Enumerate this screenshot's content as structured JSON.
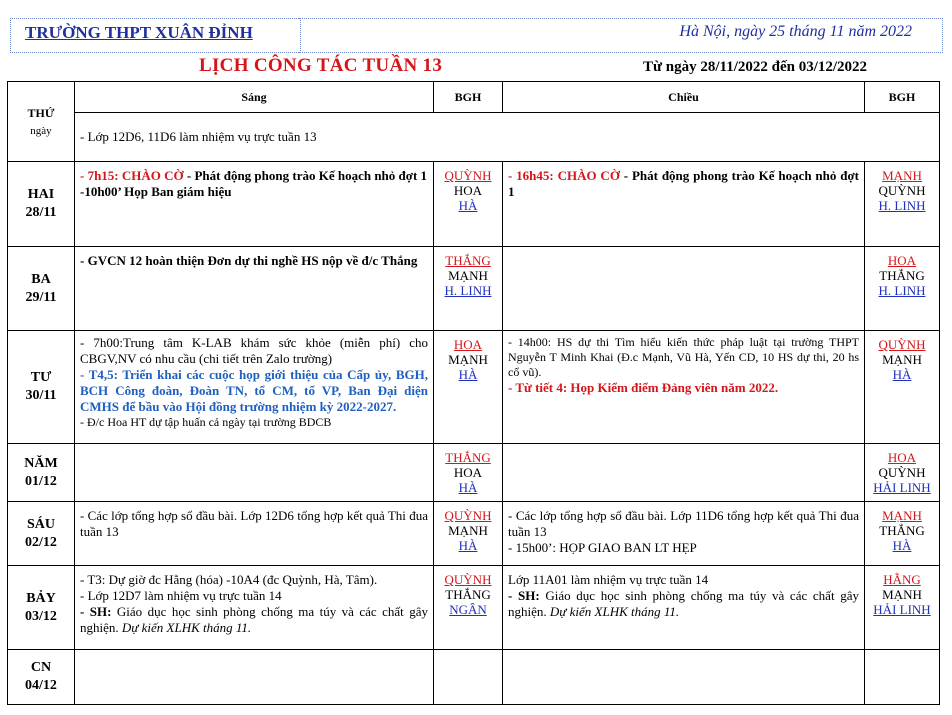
{
  "header": {
    "school": "TRƯỜNG THPT XUÂN ĐỈNH",
    "dateline": "Hà Nội, ngày  25  tháng  11  năm 2022",
    "title": "LỊCH CÔNG TÁC TUẦN 13",
    "range": "Từ ngày 28/11/2022 đến 03/12/2022"
  },
  "columns": {
    "day_line1": "THỨ",
    "day_line2": "ngày",
    "morning": "Sáng",
    "bgh": "BGH",
    "afternoon": "Chiều",
    "bgh2": "BGH"
  },
  "general_note": "- Lớp 12D6, 11D6  làm nhiệm vụ trực tuần 13",
  "rows": {
    "mon": {
      "day": "HAI",
      "date": "28/11",
      "m1_red": "- 7h15: CHÀO CỜ",
      "m1_rest": " - Phát động phong trào Kế hoạch nhỏ đợt 1",
      "m2": "-10h00’ Họp Ban giám hiệu",
      "bgh_m": [
        "QUỲNH",
        "HOA",
        "HÀ"
      ],
      "a1_red": "- 16h45: CHÀO CỜ",
      "a1_rest": " - Phát động phong trào Kế hoạch nhỏ đợt 1",
      "bgh_a": [
        "MẠNH",
        "QUỲNH",
        "H. LINH"
      ]
    },
    "tue": {
      "day": "BA",
      "date": "29/11",
      "m1": "- GVCN 12 hoàn thiện Đơn dự thi nghề HS nộp về đ/c Thắng",
      "bgh_m": [
        "THẮNG",
        "MẠNH",
        "H. LINH"
      ],
      "bgh_a": [
        "HOA",
        "THẮNG",
        "H. LINH"
      ]
    },
    "wed": {
      "day": "TƯ",
      "date": "30/11",
      "m1": "- 7h00:Trung tâm K-LAB khám sức khỏe (miễn phí) cho CBGV,NV có nhu cầu (chi tiết trên Zalo trường)",
      "m2": "- T4,5: Triển khai các cuộc họp giới thiệu của Cấp ủy, BGH, BCH Công đoàn, Đoàn TN, tổ CM, tổ VP,  Ban Đại diện CMHS để bầu vào Hội đồng trường nhiệm kỳ 2022-2027.",
      "m3": "- Đ/c Hoa HT dự tập huấn cả ngày tại trường BDCB",
      "bgh_m": [
        "HOA",
        "MẠNH",
        "HÀ"
      ],
      "a1": "- 14h00: HS dự thi Tìm hiểu kiến thức pháp luật tại trường THPT Nguyễn T Minh Khai (Đ.c Mạnh, Vũ Hà, Yến CD, 10 HS dự thi, 20 hs cổ vũ).",
      "a2": "- Từ tiết 4: Họp Kiểm điểm Đảng viên năm 2022.",
      "bgh_a": [
        "QUỲNH",
        "MẠNH",
        "HÀ"
      ]
    },
    "thu": {
      "day": "NĂM",
      "date": "01/12",
      "bgh_m": [
        "THẮNG",
        "HOA",
        "HÀ"
      ],
      "bgh_a": [
        "HOA",
        "QUỲNH",
        "HẢI LINH"
      ]
    },
    "fri": {
      "day": "SÁU",
      "date": "02/12",
      "m1": "- Các lớp tổng hợp sổ đầu bài. Lớp 12D6  tổng hợp kết quả Thi đua tuần 13",
      "bgh_m": [
        "QUỲNH",
        "MẠNH",
        "HÀ"
      ],
      "a1": "- Các lớp tổng hợp sổ đầu bài. Lớp 11D6  tổng hợp kết quả Thi đua tuần 13",
      "a2": "- 15h00’: HỌP GIAO BAN LT HẸP",
      "bgh_a": [
        "MẠNH",
        "THẮNG",
        "HÀ"
      ]
    },
    "sat": {
      "day": "BẢY",
      "date": "03/12",
      "m1": "- T3: Dự giờ đc Hằng (hóa) -10A4 (đc Quỳnh, Hà, Tâm).",
      "m2": "- Lớp 12D7  làm nhiệm vụ trực tuần 14",
      "m3_bold": "- SH:",
      "m3_rest": " Giáo dục học sinh phòng chống ma túy và các chất gây nghiện.",
      "m3_ital": " Dự kiến XLHK tháng 11.",
      "bgh_m": [
        "QUỲNH",
        "THẮNG",
        "NGÂN"
      ],
      "a1": "Lớp 11A01  làm nhiệm vụ trực tuần 14",
      "a2_bold": "- SH:",
      "a2_rest": " Giáo dục học sinh phòng chống ma túy và các chất gây nghiện.",
      "a2_ital": " Dự kiến XLHK tháng 11.",
      "bgh_a": [
        "HẰNG",
        "MẠNH",
        "HẢI LINH"
      ]
    },
    "sun": {
      "day": "CN",
      "date": "04/12"
    }
  }
}
